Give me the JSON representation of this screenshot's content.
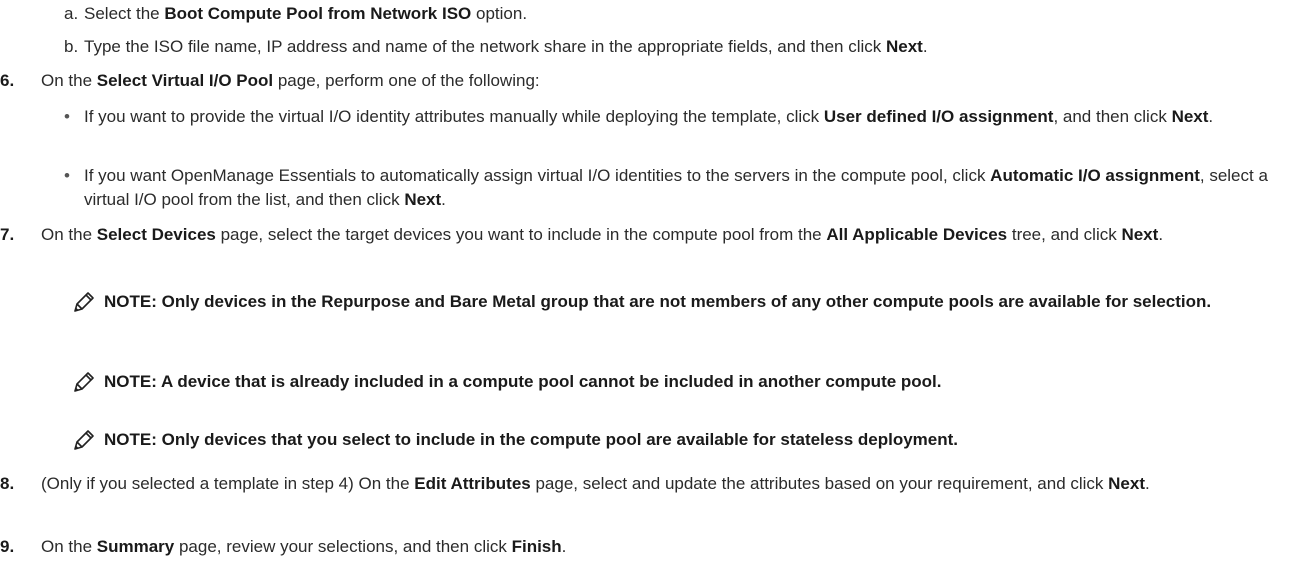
{
  "steps": {
    "a": {
      "letter": "a.",
      "pre": "Select the ",
      "b1": "Boot Compute Pool from Network ISO",
      "post": " option."
    },
    "b": {
      "letter": "b.",
      "pre": "Type the ISO file name, IP address and name of the network share in the appropriate fields, and then click ",
      "b1": "Next",
      "post": "."
    },
    "s6": {
      "num": "6.",
      "pre": "On the ",
      "b1": "Select Virtual I/O Pool",
      "post": " page, perform one of the following:",
      "bullets": [
        {
          "pre": "If you want to provide the virtual I/O identity attributes manually while deploying the template, click ",
          "b1": "User defined I/O assignment",
          "mid": ", and then click ",
          "b2": "Next",
          "post": "."
        },
        {
          "pre": "If you want OpenManage Essentials to automatically assign virtual I/O identities to the servers in the compute pool, click ",
          "b1": "Automatic I/O assignment",
          "mid": ", select a virtual I/O pool from the list, and then click ",
          "b2": "Next",
          "post": "."
        }
      ]
    },
    "s7": {
      "num": "7.",
      "pre": "On the ",
      "b1": "Select Devices",
      "mid": " page, select the target devices you want to include in the compute pool from the ",
      "b2": "All Applicable Devices",
      "mid2": " tree, and click ",
      "b3": "Next",
      "post": "."
    },
    "notes": [
      "NOTE: Only devices in the Repurpose and Bare Metal group that are not members of any other compute pools are available for selection.",
      "NOTE: A device that is already included in a compute pool cannot be included in another compute pool.",
      "NOTE: Only devices that you select to include in the compute pool are available for stateless deployment."
    ],
    "s8": {
      "num": "8.",
      "pre": "(Only if you selected a template in step 4) On the ",
      "b1": "Edit Attributes",
      "mid": " page, select and update the attributes based on your requirement, and click ",
      "b2": "Next",
      "post": "."
    },
    "s9": {
      "num": "9.",
      "pre": "On the ",
      "b1": "Summary",
      "mid": " page, review your selections, and then click ",
      "b2": "Finish",
      "post": "."
    }
  }
}
